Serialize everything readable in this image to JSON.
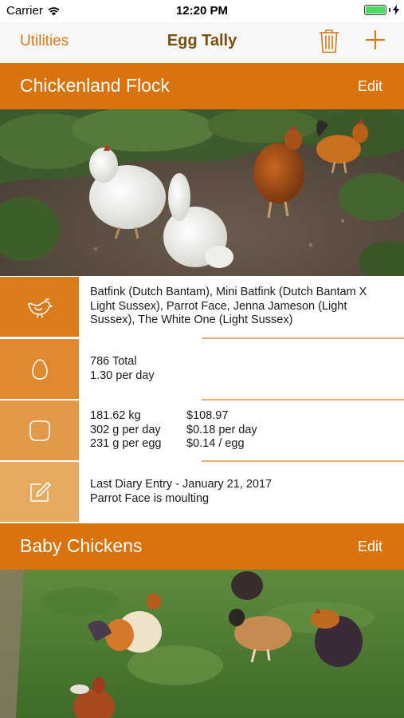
{
  "status_bar": {
    "carrier": "Carrier",
    "time": "12:20 PM"
  },
  "nav": {
    "left_label": "Utilities",
    "title": "Egg Tally",
    "trash_icon": "trash-icon",
    "add_icon": "plus-icon"
  },
  "colors": {
    "accent": "#d8730f",
    "nav_text": "#d97a14",
    "title_text": "#7a5010",
    "icon_cell_1": "#db7b1c",
    "icon_cell_2": "#df8a30",
    "icon_cell_3": "#e29a48",
    "icon_cell_4": "#e6a960",
    "divider": "#e6b070"
  },
  "flocks": [
    {
      "name": "Chickenland Flock",
      "edit_label": "Edit",
      "rows": {
        "birds": {
          "icon": "chicken-icon",
          "text": "Batfink (Dutch Bantam), Mini Batfink (Dutch Bantam X Light Sussex), Parrot Face, Jenna Jameson (Light Sussex), The White One (Light Sussex)"
        },
        "eggs": {
          "icon": "egg-icon",
          "total": "786 Total",
          "per_day": "1.30 per day"
        },
        "weight_cost": {
          "icon": "weight-icon",
          "weight_total": "181.62 kg",
          "weight_per_day": "302 g per day",
          "weight_per_egg": "231 g per egg",
          "cost_total": "$108.97",
          "cost_per_day": "$0.18 per day",
          "cost_per_egg": "$0.14 / egg"
        },
        "diary": {
          "icon": "edit-icon",
          "title": "Last Diary Entry - January 21, 2017",
          "entry": "Parrot Face is moulting"
        }
      }
    },
    {
      "name": "Baby Chickens",
      "edit_label": "Edit"
    }
  ]
}
